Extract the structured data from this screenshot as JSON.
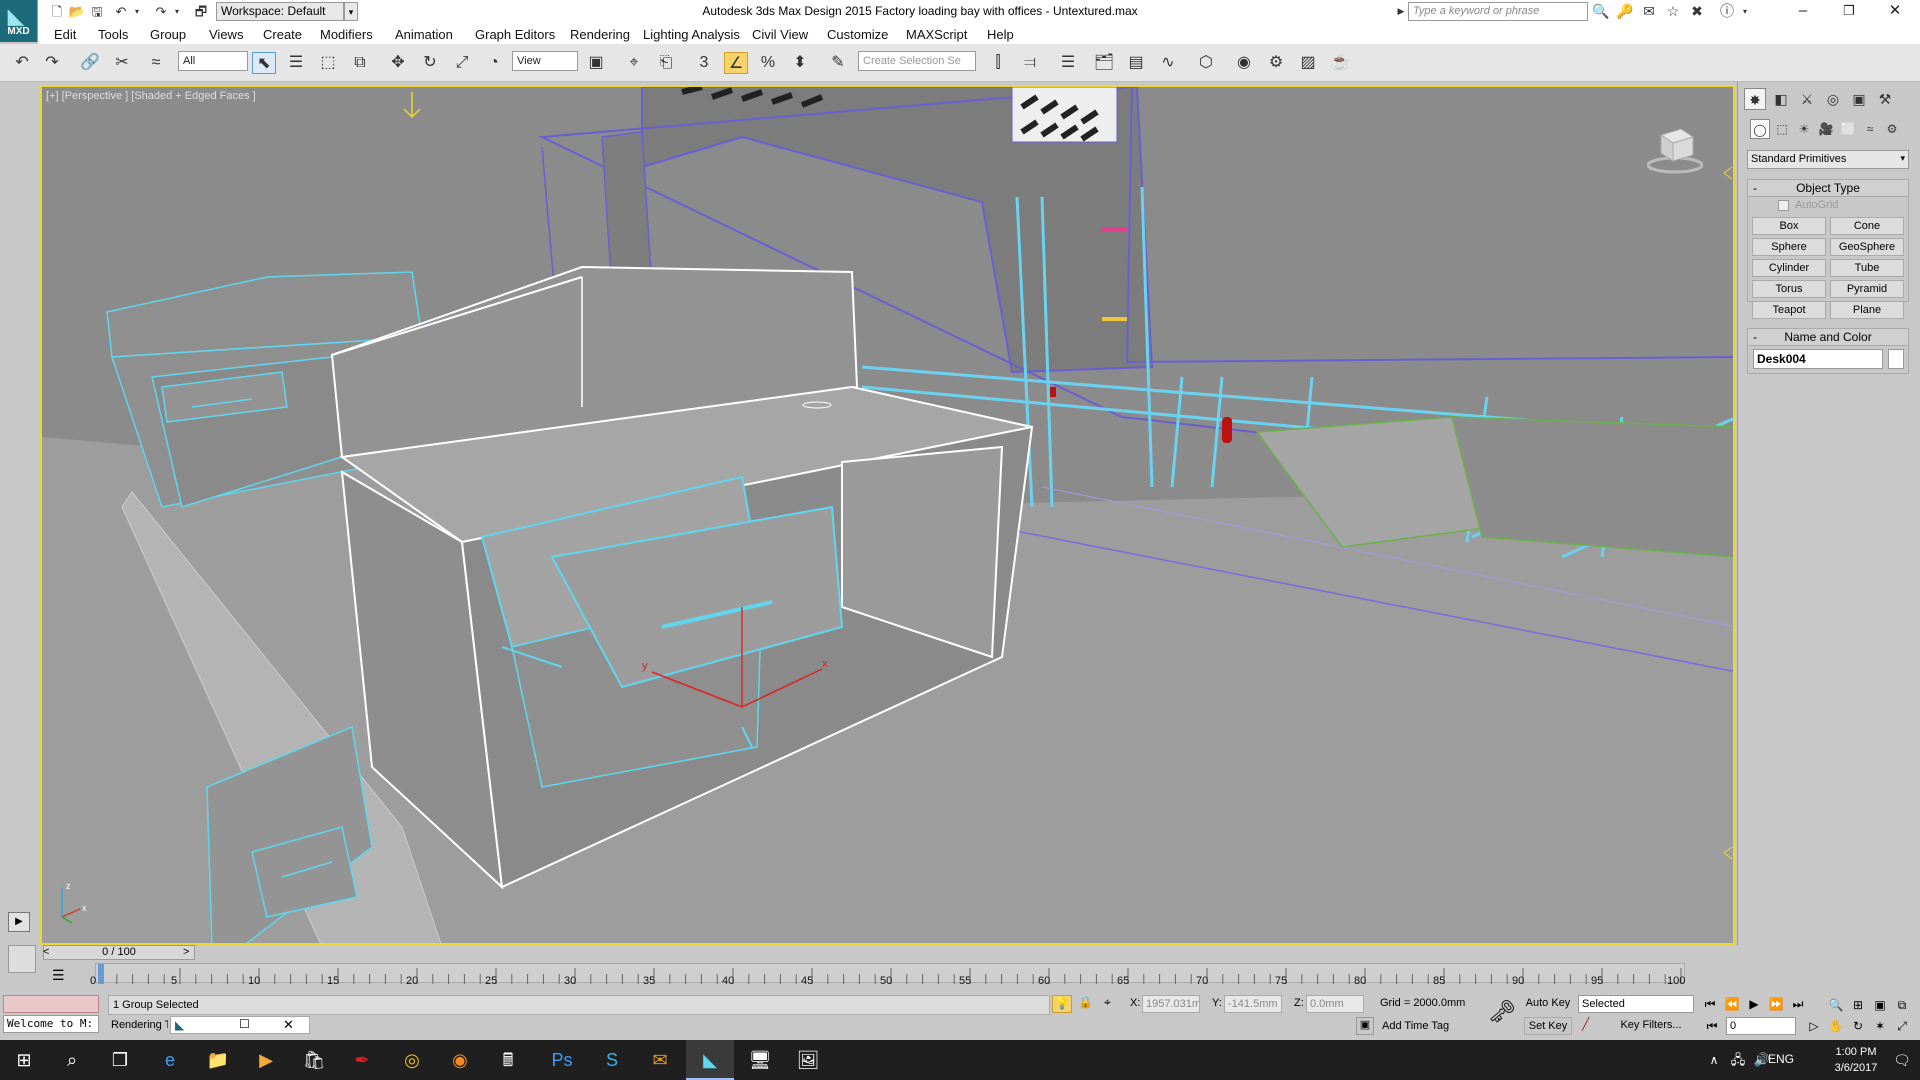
{
  "titlebar": {
    "app_logo": "MXD",
    "workspace_select": "Workspace: Default",
    "title": "Autodesk 3ds Max Design 2015    Factory loading bay with offices - Untextured.max",
    "search_placeholder": "Type a keyword or phrase"
  },
  "menu": [
    "Edit",
    "Tools",
    "Group",
    "Views",
    "Create",
    "Modifiers",
    "Animation",
    "Graph Editors",
    "Rendering",
    "Lighting Analysis",
    "Civil View",
    "Customize",
    "MAXScript",
    "Help"
  ],
  "toolbar": {
    "selection_filter": "All",
    "ref_coord": "View",
    "snap_label": "3",
    "named_selection_placeholder": "Create Selection Se"
  },
  "viewport": {
    "label": "[+] [Perspective ] [Shaded + Edged Faces ]",
    "gizmo_axes": [
      "x",
      "y",
      "z"
    ],
    "viewcube_labels": [
      "FRONT",
      "LEFT"
    ]
  },
  "command_panel": {
    "category_select": "Standard Primitives",
    "object_type_title": "Object Type",
    "autogrid_label": "AutoGrid",
    "primitives": [
      "Box",
      "Cone",
      "Sphere",
      "GeoSphere",
      "Cylinder",
      "Tube",
      "Torus",
      "Pyramid",
      "Teapot",
      "Plane"
    ],
    "name_color_title": "Name and Color",
    "object_name": "Desk004"
  },
  "timeline": {
    "time_slider": "0 / 100",
    "ticks": [
      "0",
      "5",
      "10",
      "15",
      "20",
      "25",
      "30",
      "35",
      "40",
      "45",
      "50",
      "55",
      "60",
      "65",
      "70",
      "75",
      "80",
      "85",
      "90",
      "95",
      "100"
    ]
  },
  "status": {
    "maxscript_text": "Welcome to M:",
    "selection": "1 Group Selected",
    "rendering": "Rendering T",
    "x_label": "X:",
    "x_value": "1957.031m",
    "y_label": "Y:",
    "y_value": "-141.5mm",
    "z_label": "Z:",
    "z_value": "0.0mm",
    "grid": "Grid = 2000.0mm",
    "add_time_tag": "Add Time Tag",
    "auto_key": "Auto Key",
    "set_key": "Set Key",
    "key_mode": "Selected",
    "key_filters": "Key Filters...",
    "frame": "0"
  },
  "taskbar": {
    "lang": "ENG",
    "time": "1:00 PM",
    "date": "3/6/2017"
  },
  "colors": {
    "viewport_border": "#ecd637",
    "selection_wire": "#5fd6ee",
    "active_tool": "#f6d36b"
  }
}
